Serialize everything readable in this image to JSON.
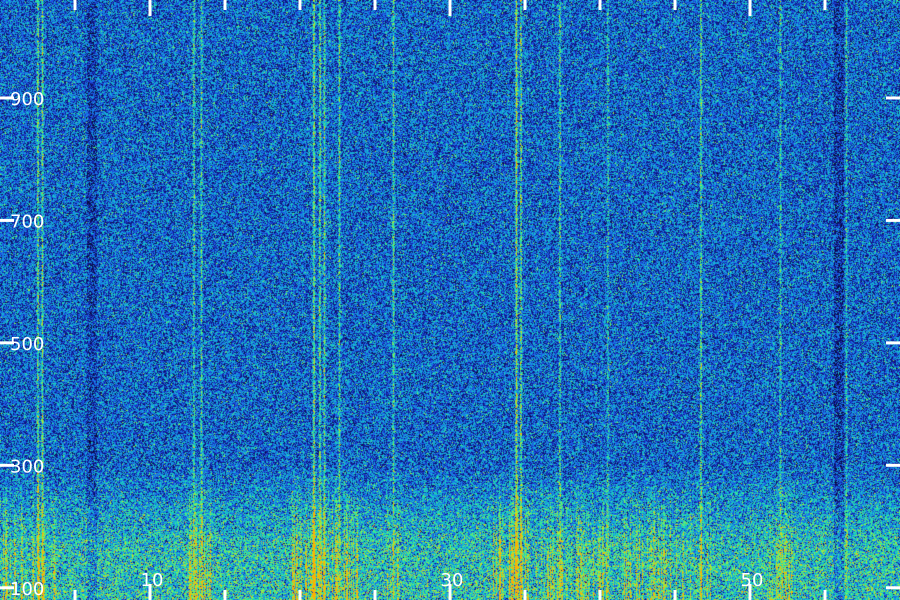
{
  "chart_data": {
    "type": "heatmap",
    "title": "",
    "xlabel": "",
    "ylabel": "",
    "x_tick_labels": [
      "10",
      "30",
      "50"
    ],
    "x_tick_values": [
      10,
      30,
      50
    ],
    "y_tick_labels": [
      "100",
      "300",
      "500",
      "700",
      "900"
    ],
    "y_tick_values": [
      100,
      300,
      500,
      700,
      900
    ],
    "xlim": [
      0,
      60
    ],
    "ylim": [
      80,
      1060
    ],
    "colormap": [
      "#06061a",
      "#10168a",
      "#1f50e8",
      "#12a6e0",
      "#22e8a8",
      "#a6f23a",
      "#ffb000"
    ],
    "background": "#000000",
    "tick_color": "#ffffff",
    "base_intensity": 0.36,
    "low_band": {
      "y_max": 300,
      "boost": 0.28
    },
    "lines": [
      {
        "x": 2.5,
        "strength": 0.5
      },
      {
        "x": 2.8,
        "strength": 0.45
      },
      {
        "x": 12.9,
        "strength": 0.4
      },
      {
        "x": 13.4,
        "strength": 0.35
      },
      {
        "x": 20.9,
        "strength": 0.55
      },
      {
        "x": 21.3,
        "strength": 0.5
      },
      {
        "x": 21.6,
        "strength": 0.4
      },
      {
        "x": 22.6,
        "strength": 0.35
      },
      {
        "x": 26.2,
        "strength": 0.35
      },
      {
        "x": 34.4,
        "strength": 0.6
      },
      {
        "x": 34.7,
        "strength": 0.5
      },
      {
        "x": 37.3,
        "strength": 0.4
      },
      {
        "x": 40.5,
        "strength": 0.3
      },
      {
        "x": 46.7,
        "strength": 0.45
      },
      {
        "x": 52.0,
        "strength": 0.3
      },
      {
        "x": 56.4,
        "strength": 0.25
      }
    ],
    "low_clusters": [
      {
        "x_start": 0.2,
        "x_end": 3.8,
        "strength": 0.35
      },
      {
        "x_start": 12.6,
        "x_end": 14.0,
        "strength": 0.35
      },
      {
        "x_start": 19.5,
        "x_end": 24.0,
        "strength": 0.45
      },
      {
        "x_start": 25.8,
        "x_end": 26.6,
        "strength": 0.3
      },
      {
        "x_start": 32.8,
        "x_end": 35.2,
        "strength": 0.5
      },
      {
        "x_start": 35.8,
        "x_end": 40.4,
        "strength": 0.3
      },
      {
        "x_start": 41.6,
        "x_end": 47.4,
        "strength": 0.3
      },
      {
        "x_start": 51.0,
        "x_end": 52.8,
        "strength": 0.25
      }
    ],
    "dark_columns": [
      {
        "x": 6.1,
        "width": 0.25,
        "depth": 0.12
      },
      {
        "x": 55.9,
        "width": 0.3,
        "depth": 0.14
      }
    ]
  }
}
